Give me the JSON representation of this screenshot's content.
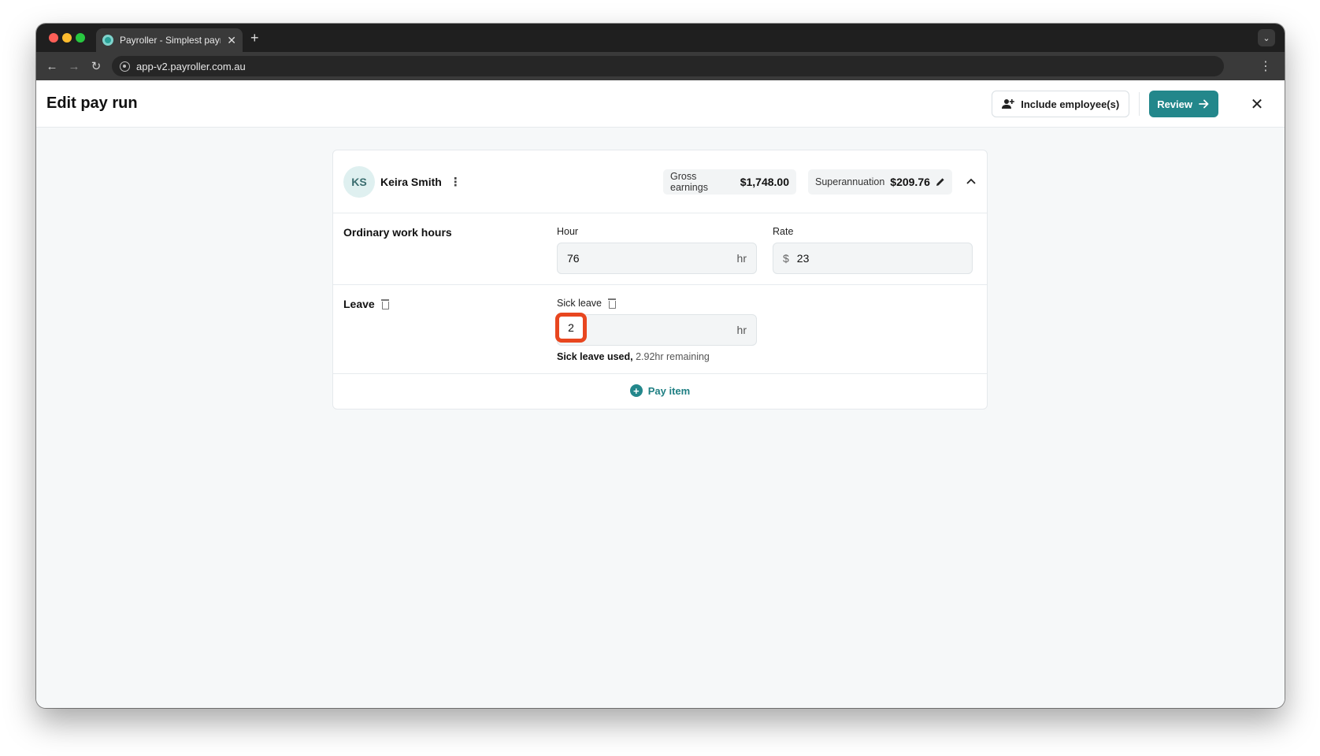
{
  "browser": {
    "tab_title": "Payroller - Simplest payroll so",
    "new_tab": "+",
    "url": "app-v2.payroller.com.au"
  },
  "header": {
    "title": "Edit pay run",
    "include_label": "Include employee(s)",
    "review_label": "Review"
  },
  "employee": {
    "initials": "KS",
    "name": "Keira Smith",
    "gross_label": "Gross earnings",
    "gross_value": "$1,748.00",
    "super_label": "Superannuation",
    "super_value": "$209.76"
  },
  "ordinary": {
    "title": "Ordinary work hours",
    "hour_label": "Hour",
    "hour_value": "76",
    "hour_suffix": "hr",
    "rate_label": "Rate",
    "rate_prefix": "$",
    "rate_value": "23"
  },
  "leave": {
    "title": "Leave",
    "sick_label": "Sick leave",
    "sick_value": "2",
    "sick_suffix": "hr",
    "used_text": "Sick leave used,",
    "remaining_text": "2.92hr remaining"
  },
  "pay_item_label": "Pay item",
  "colors": {
    "accent": "#23878b",
    "highlight": "#e8461f"
  }
}
